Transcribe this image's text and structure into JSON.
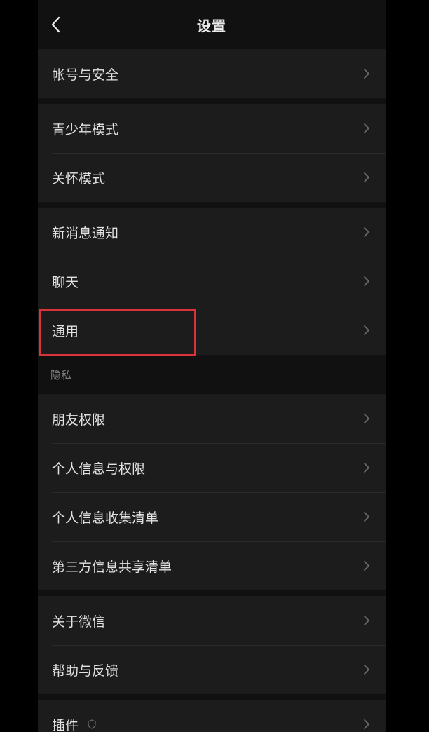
{
  "header": {
    "title": "设置",
    "back_icon": "chevron-left-icon"
  },
  "groups": [
    {
      "items": [
        {
          "label": "帐号与安全"
        }
      ]
    },
    {
      "items": [
        {
          "label": "青少年模式"
        },
        {
          "label": "关怀模式"
        }
      ]
    },
    {
      "items": [
        {
          "label": "新消息通知"
        },
        {
          "label": "聊天"
        },
        {
          "label": "通用"
        }
      ]
    },
    {
      "section": "隐私",
      "items": [
        {
          "label": "朋友权限"
        },
        {
          "label": "个人信息与权限"
        },
        {
          "label": "个人信息收集清单"
        },
        {
          "label": "第三方信息共享清单"
        }
      ]
    },
    {
      "items": [
        {
          "label": "关于微信"
        },
        {
          "label": "帮助与反馈"
        }
      ]
    },
    {
      "items": [
        {
          "label": "插件"
        }
      ]
    }
  ],
  "colors": {
    "background": "#111111",
    "row_background": "#1c1c1c",
    "text": "#e2e2e2",
    "highlight": "#d8343a"
  }
}
